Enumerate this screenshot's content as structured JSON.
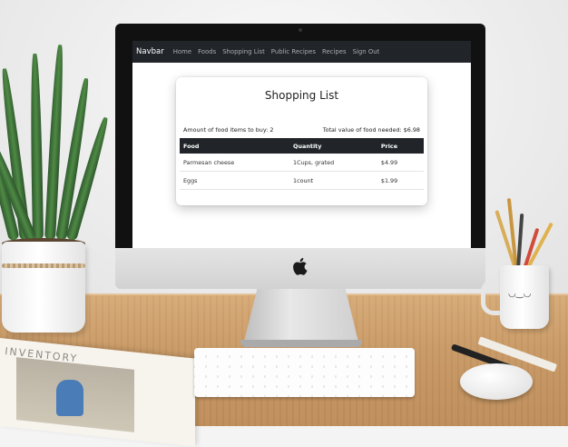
{
  "navbar": {
    "brand": "Navbar",
    "links": [
      "Home",
      "Foods",
      "Shopping List",
      "Public Recipes",
      "Recipes",
      "Sign Out"
    ]
  },
  "page": {
    "title": "Shopping List",
    "items_label": "Amount of food items to buy: 2",
    "total_label": "Total value of food needed: $6.98"
  },
  "table": {
    "headers": [
      "Food",
      "Quantity",
      "Price"
    ],
    "rows": [
      [
        "Parmesan cheese",
        "1Cups, grated",
        "$4.99"
      ],
      [
        "Eggs",
        "1count",
        "$1.99"
      ]
    ]
  },
  "props": {
    "book_title": "INVENTORY",
    "cup_face": "◡‿◡"
  },
  "colors": {
    "navbar_bg": "#212529",
    "nav_link": "#a7acb1",
    "table_header_bg": "#212529"
  }
}
